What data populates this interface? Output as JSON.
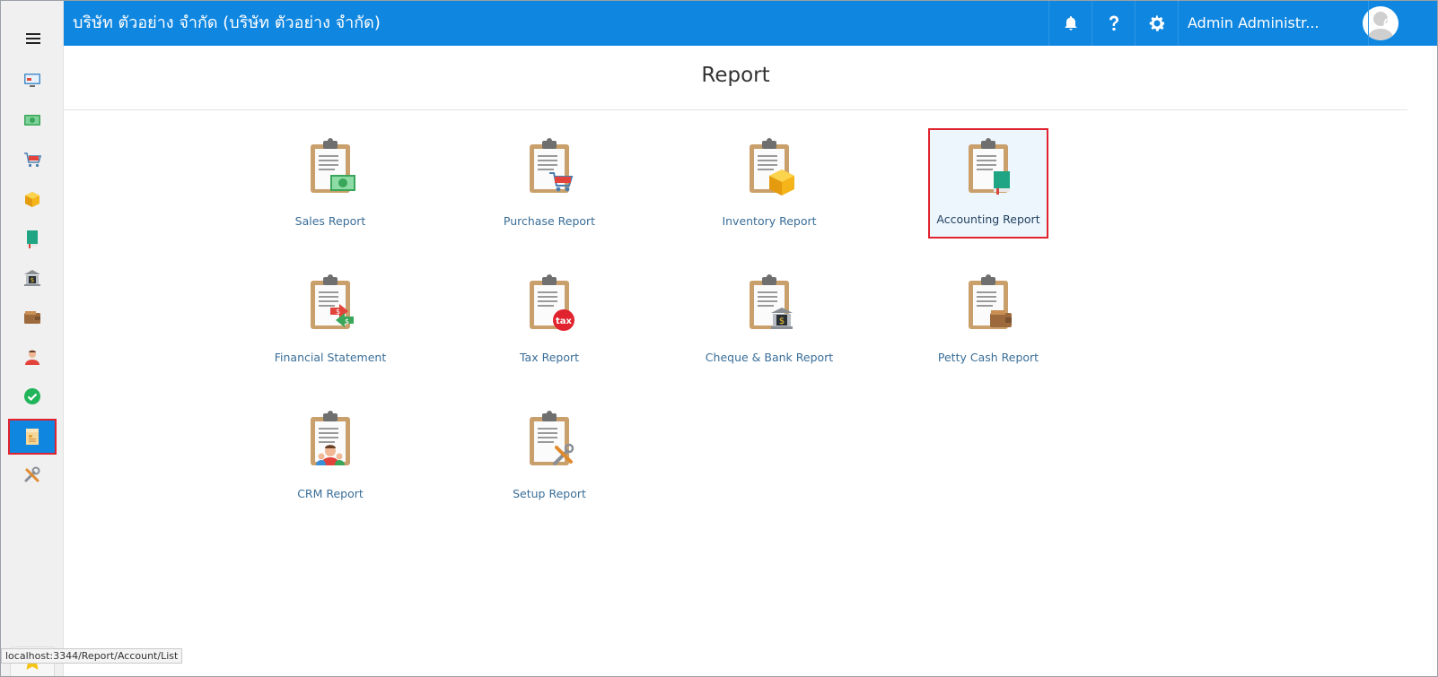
{
  "header": {
    "company": "บริษัท ตัวอย่าง จำกัด (บริษัท ตัวอย่าง จำกัด)",
    "user_name": "Admin Administr...",
    "brand_color": "#0f86e0"
  },
  "sidebar": {
    "items": [
      {
        "name": "dashboard",
        "icon": "monitor-icon"
      },
      {
        "name": "sales",
        "icon": "money-icon"
      },
      {
        "name": "purchase",
        "icon": "cart-icon"
      },
      {
        "name": "inventory",
        "icon": "box-icon"
      },
      {
        "name": "accounting",
        "icon": "book-icon"
      },
      {
        "name": "bank",
        "icon": "bank-icon"
      },
      {
        "name": "petty-cash",
        "icon": "wallet-icon"
      },
      {
        "name": "crm",
        "icon": "people-icon"
      },
      {
        "name": "approve",
        "icon": "check-icon"
      },
      {
        "name": "report",
        "icon": "report-icon",
        "active": true
      },
      {
        "name": "setup",
        "icon": "tools-icon"
      }
    ],
    "favorite_icon": "star-icon"
  },
  "main": {
    "title": "Report",
    "reports": [
      {
        "label": "Sales Report",
        "icon": "sales-report-icon"
      },
      {
        "label": "Purchase Report",
        "icon": "purchase-report-icon"
      },
      {
        "label": "Inventory Report",
        "icon": "inventory-report-icon"
      },
      {
        "label": "Accounting Report",
        "icon": "accounting-report-icon",
        "selected": true
      },
      {
        "label": "Financial Statement",
        "icon": "financial-statement-icon"
      },
      {
        "label": "Tax Report",
        "icon": "tax-report-icon",
        "badge": "tax"
      },
      {
        "label": "Cheque & Bank Report",
        "icon": "cheque-bank-report-icon"
      },
      {
        "label": "Petty Cash Report",
        "icon": "petty-cash-report-icon"
      },
      {
        "label": "CRM Report",
        "icon": "crm-report-icon"
      },
      {
        "label": "Setup Report",
        "icon": "setup-report-icon"
      }
    ]
  },
  "status_url": "localhost:3344/Report/Account/List",
  "colors": {
    "highlight": "#e0232e",
    "link": "#3a6e98"
  }
}
